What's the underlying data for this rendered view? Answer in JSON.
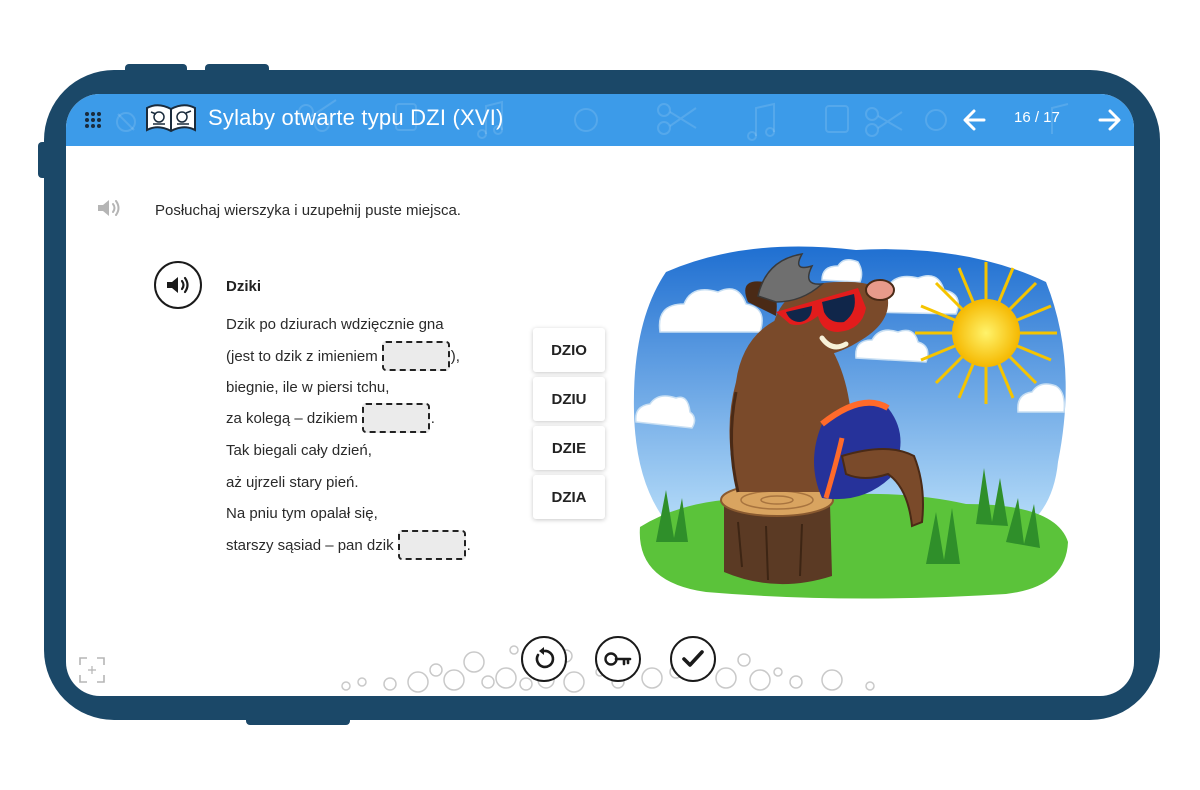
{
  "header": {
    "title": "Sylaby otwarte typu DZI (XVI)",
    "page_counter": "16 / 17",
    "background_color": "#3c9be9",
    "icons": [
      "menu-grid-icon",
      "book-icon",
      "arrow-left-icon",
      "arrow-right-icon"
    ]
  },
  "exercise": {
    "instruction": "Posłuchaj wierszyka i uzupełnij puste miejsca.",
    "poem_title": "Dziki",
    "lines": [
      {
        "before": "Dzik po dziurach wdzięcznie gna",
        "after": ""
      },
      {
        "before": "(jest to dzik z imieniem",
        "after": "),"
      },
      {
        "before": "biegnie, ile w piersi tchu,",
        "after": ""
      },
      {
        "before": "za kolegą – dzikiem",
        "after": "."
      },
      {
        "before": "Tak biegali cały dzień,",
        "after": ""
      },
      {
        "before": "aż ujrzeli stary pień.",
        "after": ""
      },
      {
        "before": "Na pniu tym opalał się,",
        "after": ""
      },
      {
        "before": "starszy sąsiad – pan dzik",
        "after": "."
      }
    ],
    "syllables": [
      "DZIO",
      "DZIU",
      "DZIE",
      "DZIA"
    ]
  },
  "controls": {
    "icons": [
      "reset-icon",
      "key-icon",
      "check-icon",
      "fullscreen-icon"
    ]
  },
  "frame_color": "#1b4868"
}
